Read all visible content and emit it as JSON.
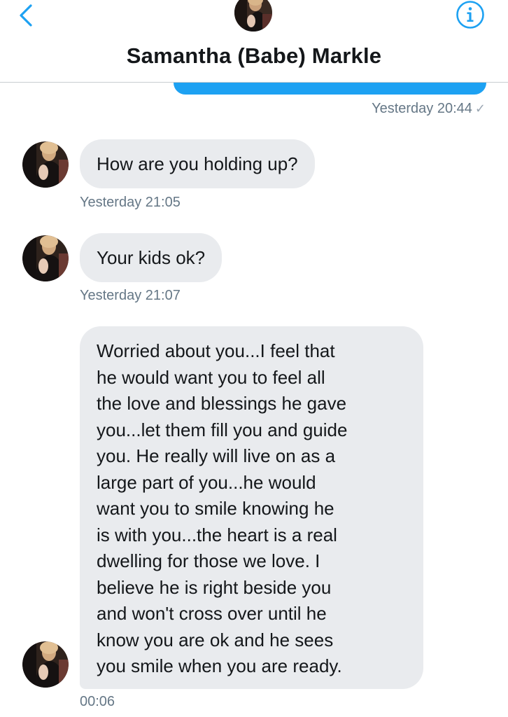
{
  "header": {
    "title": "Samantha (Babe) Markle",
    "back_icon": "chevron-left-icon",
    "info_icon": "info-icon",
    "accent_color": "#1da1f2"
  },
  "messages": [
    {
      "direction": "sent",
      "text": "",
      "timestamp": "Yesterday 20:44",
      "status": "✓"
    },
    {
      "direction": "received",
      "text": "How are you holding up?",
      "timestamp": "Yesterday 21:05"
    },
    {
      "direction": "received",
      "text": "Your kids ok?",
      "timestamp": "Yesterday 21:07"
    },
    {
      "direction": "received",
      "lines": [
        "Worried about you...I feel that",
        "he would want you to feel all",
        "the love and blessings he gave",
        "you...let them fill you and guide",
        "you. He really will live on as a",
        "large part of you...he would",
        "want you to smile knowing he",
        "is with you...the heart is a real",
        "dwelling for those we love. I",
        "believe he is right beside you",
        "and won't cross over until he",
        "know you are ok and he sees",
        "you smile when you are ready."
      ],
      "timestamp": "00:06"
    }
  ]
}
